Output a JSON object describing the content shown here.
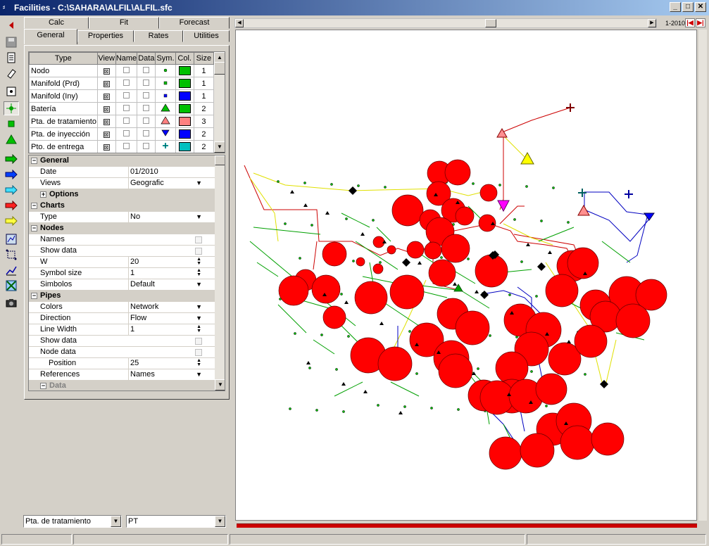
{
  "window": {
    "title": "Facilities - C:\\SAHARA\\ALFIL\\ALFIL.sfc",
    "min_label": "_",
    "max_label": "□",
    "close_label": "✕"
  },
  "tabs": {
    "row1": [
      "Calc",
      "Fit",
      "Forecast"
    ],
    "row2": [
      "General",
      "Properties",
      "Rates",
      "Utilities"
    ],
    "active": "General"
  },
  "types_table": {
    "headers": [
      "Type",
      "View",
      "Name",
      "Data",
      "Sym.",
      "Col.",
      "Size"
    ],
    "rows": [
      {
        "type": "Nodo",
        "view": true,
        "name": false,
        "data": false,
        "sym": "dot",
        "color": "#00c000",
        "size": "1"
      },
      {
        "type": "Manifold (Prd)",
        "view": true,
        "name": false,
        "data": false,
        "sym": "square",
        "color": "#00c000",
        "size": "1"
      },
      {
        "type": "Manifold (Iny)",
        "view": true,
        "name": false,
        "data": false,
        "sym": "square",
        "color": "#0000ff",
        "size": "1"
      },
      {
        "type": "Batería",
        "view": true,
        "name": false,
        "data": false,
        "sym": "triangle",
        "color": "#00c000",
        "size": "2"
      },
      {
        "type": "Pta. de tratamiento",
        "view": true,
        "name": false,
        "data": false,
        "sym": "triangle",
        "color": "#ff8080",
        "size": "3"
      },
      {
        "type": "Pta. de inyección",
        "view": true,
        "name": false,
        "data": false,
        "sym": "triangle-down",
        "color": "#0000ff",
        "size": "2"
      },
      {
        "type": "Pto. de entrega",
        "view": true,
        "name": false,
        "data": false,
        "sym": "cross",
        "color": "#00c0c0",
        "size": "2"
      }
    ]
  },
  "properties": [
    {
      "kind": "section",
      "label": "General",
      "box": "−"
    },
    {
      "kind": "prop",
      "name": "Date",
      "value": "01/2010",
      "ctl": "none"
    },
    {
      "kind": "prop",
      "name": "Views",
      "value": "Geografic",
      "ctl": "dropdown"
    },
    {
      "kind": "subsection",
      "label": "Options",
      "box": "+"
    },
    {
      "kind": "section",
      "label": "Charts",
      "box": "−"
    },
    {
      "kind": "prop",
      "name": "Type",
      "value": "No",
      "ctl": "dropdown"
    },
    {
      "kind": "section",
      "label": "Nodes",
      "box": "−"
    },
    {
      "kind": "prop",
      "name": "Names",
      "value": "",
      "ctl": "checkbox"
    },
    {
      "kind": "prop",
      "name": "Show data",
      "value": "",
      "ctl": "checkbox"
    },
    {
      "kind": "prop",
      "name": "W",
      "value": "20",
      "ctl": "spin"
    },
    {
      "kind": "prop",
      "name": "Symbol size",
      "value": "1",
      "ctl": "spin"
    },
    {
      "kind": "prop",
      "name": "Simbolos",
      "value": "Default",
      "ctl": "dropdown"
    },
    {
      "kind": "section",
      "label": "Pipes",
      "box": "−"
    },
    {
      "kind": "prop",
      "name": "Colors",
      "value": "Network",
      "ctl": "dropdown"
    },
    {
      "kind": "prop",
      "name": "Direction",
      "value": "Flow",
      "ctl": "dropdown"
    },
    {
      "kind": "prop",
      "name": "Line Width",
      "value": "1",
      "ctl": "spin"
    },
    {
      "kind": "prop",
      "name": "Show data",
      "value": "",
      "ctl": "checkbox"
    },
    {
      "kind": "prop",
      "name": "Node data",
      "value": "",
      "ctl": "checkbox"
    },
    {
      "kind": "prop",
      "name": "Position",
      "value": "25",
      "ctl": "spin",
      "indent": true
    },
    {
      "kind": "prop",
      "name": "References",
      "value": "Names",
      "ctl": "dropdown"
    },
    {
      "kind": "subsection",
      "label": "Data",
      "box": "−",
      "disabled": true
    }
  ],
  "bottom": {
    "type_combo": "Pta. de tratamiento",
    "name_combo": "PT"
  },
  "time_nav": {
    "period_label": "1-2010"
  },
  "colors": {
    "bubble": "#ff0000",
    "pipe_green": "#00a000",
    "pipe_blue": "#0000c0",
    "pipe_red": "#cc0000",
    "pipe_yellow": "#e0e000",
    "diamond": "#000000"
  }
}
